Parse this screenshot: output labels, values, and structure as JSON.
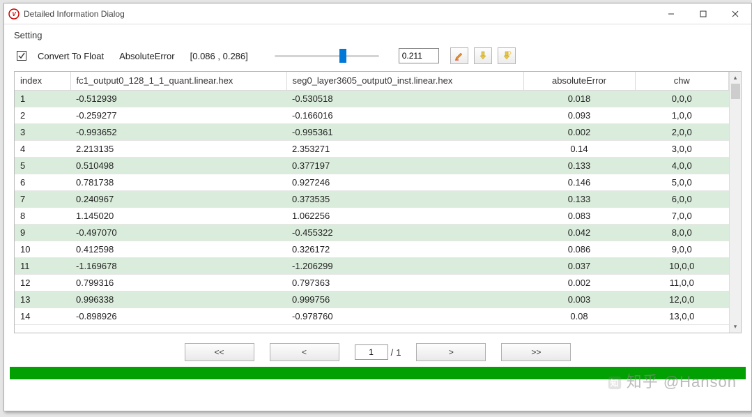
{
  "window": {
    "title": "Detailed Information Dialog"
  },
  "toolbar": {
    "setting_label": "Setting",
    "convert_to_float": "Convert To Float",
    "error_mode": "AbsoluteError",
    "range_text": "[0.086 , 0.286]",
    "value": "0.211",
    "slider_percent": 62
  },
  "icons": {
    "edit": "edit-icon",
    "down1": "insert-down-icon",
    "down2": "highlight-down-icon"
  },
  "table": {
    "headers": {
      "index": "index",
      "a": "fc1_output0_128_1_1_quant.linear.hex",
      "b": "seg0_layer3605_output0_inst.linear.hex",
      "err": "absoluteError",
      "chw": "chw"
    },
    "rows": [
      {
        "index": "1",
        "a": "-0.512939",
        "b": "-0.530518",
        "err": "0.018",
        "chw": "0,0,0"
      },
      {
        "index": "2",
        "a": "-0.259277",
        "b": "-0.166016",
        "err": "0.093",
        "chw": "1,0,0"
      },
      {
        "index": "3",
        "a": "-0.993652",
        "b": "-0.995361",
        "err": "0.002",
        "chw": "2,0,0"
      },
      {
        "index": "4",
        "a": "2.213135",
        "b": "2.353271",
        "err": "0.14",
        "chw": "3,0,0"
      },
      {
        "index": "5",
        "a": "0.510498",
        "b": "0.377197",
        "err": "0.133",
        "chw": "4,0,0"
      },
      {
        "index": "6",
        "a": "0.781738",
        "b": "0.927246",
        "err": "0.146",
        "chw": "5,0,0"
      },
      {
        "index": "7",
        "a": "0.240967",
        "b": "0.373535",
        "err": "0.133",
        "chw": "6,0,0"
      },
      {
        "index": "8",
        "a": "1.145020",
        "b": "1.062256",
        "err": "0.083",
        "chw": "7,0,0"
      },
      {
        "index": "9",
        "a": "-0.497070",
        "b": "-0.455322",
        "err": "0.042",
        "chw": "8,0,0"
      },
      {
        "index": "10",
        "a": "0.412598",
        "b": "0.326172",
        "err": "0.086",
        "chw": "9,0,0"
      },
      {
        "index": "11",
        "a": "-1.169678",
        "b": "-1.206299",
        "err": "0.037",
        "chw": "10,0,0"
      },
      {
        "index": "12",
        "a": "0.799316",
        "b": "0.797363",
        "err": "0.002",
        "chw": "11,0,0"
      },
      {
        "index": "13",
        "a": "0.996338",
        "b": "0.999756",
        "err": "0.003",
        "chw": "12,0,0"
      },
      {
        "index": "14",
        "a": "-0.898926",
        "b": "-0.978760",
        "err": "0.08",
        "chw": "13,0,0"
      }
    ]
  },
  "pager": {
    "first": "<<",
    "prev": "<",
    "current": "1",
    "sep": "/",
    "total": "1",
    "next": ">",
    "last": ">>"
  },
  "watermark": "知乎 @Hanson"
}
